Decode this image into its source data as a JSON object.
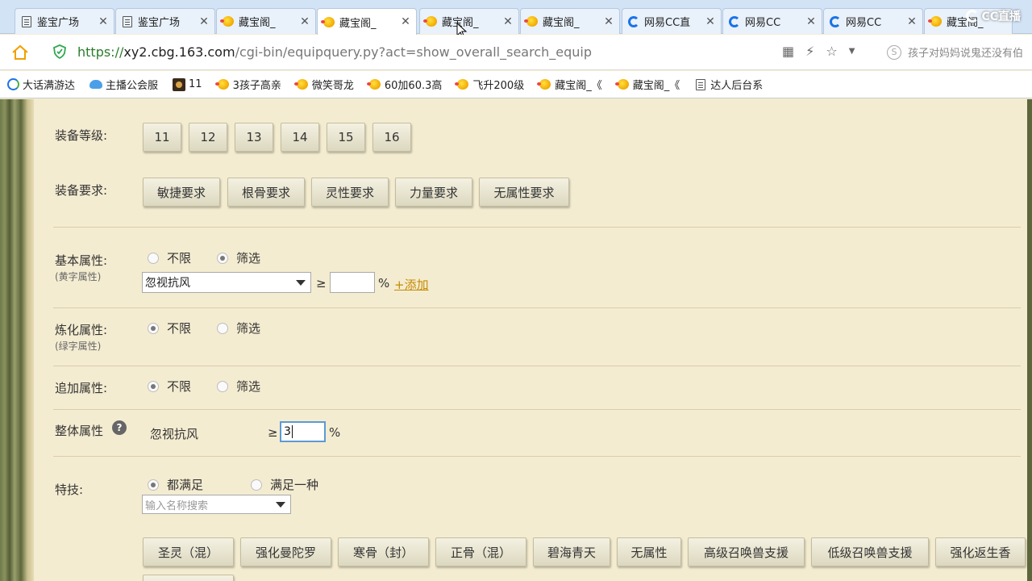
{
  "tabs": [
    {
      "icon": "document-icon",
      "label": "鉴宝广场"
    },
    {
      "icon": "document-icon",
      "label": "鉴宝广场"
    },
    {
      "icon": "treasure-chick-icon",
      "label": "藏宝阁_"
    },
    {
      "icon": "treasure-chick-icon",
      "label": "藏宝阁_"
    },
    {
      "icon": "treasure-chick-icon",
      "label": "藏宝阁_"
    },
    {
      "icon": "treasure-chick-icon",
      "label": "藏宝阁_"
    },
    {
      "icon": "netease-cc-icon",
      "label": "网易CC直"
    },
    {
      "icon": "netease-cc-icon",
      "label": "网易CC"
    },
    {
      "icon": "netease-cc-icon",
      "label": "网易CC"
    },
    {
      "icon": "treasure-chick-icon",
      "label": "藏宝阁_"
    }
  ],
  "active_tab": 3,
  "watermark": "CC直播",
  "address": {
    "scheme": "https://",
    "host": "xy2.cbg.163.com",
    "path": "/cgi-bin/equipquery.py?act=show_overall_search_equip",
    "search_hint": "孩子对妈妈说鬼还没有伯"
  },
  "bookmarks": [
    {
      "icon": "globe-icon",
      "label": "大话满游达"
    },
    {
      "icon": "cloud-icon",
      "label": "主播公会服"
    },
    {
      "icon": "game-icon",
      "label": "11"
    },
    {
      "icon": "treasure-chick-icon",
      "label": "3孩子高亲"
    },
    {
      "icon": "treasure-chick-icon",
      "label": "微笑哥龙"
    },
    {
      "icon": "treasure-chick-icon",
      "label": "60加60.3高"
    },
    {
      "icon": "treasure-chick-icon",
      "label": "飞升200级"
    },
    {
      "icon": "treasure-chick-icon",
      "label": "藏宝阁_《"
    },
    {
      "icon": "treasure-chick-icon",
      "label": "藏宝阁_《"
    },
    {
      "icon": "document-icon",
      "label": "达人后台系"
    }
  ],
  "form": {
    "equip_level": {
      "label": "装备等级:",
      "options": [
        "11",
        "12",
        "13",
        "14",
        "15",
        "16"
      ]
    },
    "equip_req": {
      "label": "装备要求:",
      "options": [
        "敏捷要求",
        "根骨要求",
        "灵性要求",
        "力量要求",
        "无属性要求"
      ]
    },
    "basic_attr": {
      "label": "基本属性:",
      "sublabel": "(黄字属性)",
      "radio_any": "不限",
      "radio_filter": "筛选",
      "selected": "filter",
      "select_value": "忽视抗风",
      "ge": "≥",
      "input_value": "",
      "unit": "%",
      "add_link": "+添加"
    },
    "refine_attr": {
      "label": "炼化属性:",
      "sublabel": "(绿字属性)",
      "radio_any": "不限",
      "radio_filter": "筛选",
      "selected": "any"
    },
    "extra_attr": {
      "label": "追加属性:",
      "radio_any": "不限",
      "radio_filter": "筛选",
      "selected": "any"
    },
    "overall_attr": {
      "label": "整体属性",
      "help": "?",
      "name": "忽视抗风",
      "ge": "≥",
      "input_value": "3",
      "unit": "%"
    },
    "skills": {
      "label": "特技:",
      "radio_all": "都满足",
      "radio_one": "满足一种",
      "selected": "all",
      "search_placeholder": "输入名称搜索",
      "options": [
        "圣灵（混）",
        "强化曼陀罗",
        "寒骨（封）",
        "正骨（混）",
        "碧海青天",
        "无属性",
        "高级召唤兽支援",
        "低级召唤兽支援",
        "强化返生香"
      ]
    }
  },
  "colors": {
    "page_bg": "#f4ecd1",
    "tab_strip": "#d3e3f6",
    "link": "#c58a00",
    "url_green": "#2a7d2a"
  }
}
